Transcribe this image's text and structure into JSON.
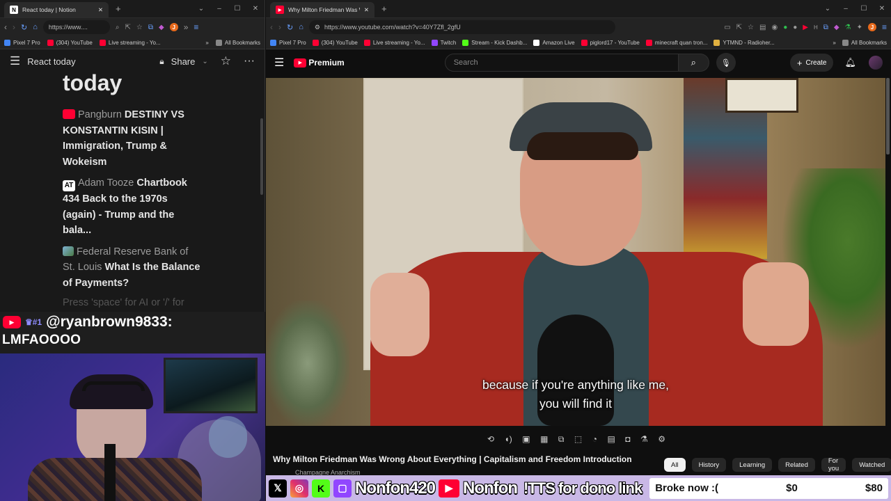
{
  "left_browser": {
    "tab_title": "React today | Notion",
    "url": "https://www....",
    "bookmarks": [
      "Pixel 7 Pro",
      "(304) YouTube",
      "Live streaming - Yo..."
    ],
    "all_bookmarks": "All Bookmarks",
    "notion": {
      "page_name": "React today",
      "share_label": "Share",
      "title": "today",
      "items": [
        {
          "source": "Pangburn",
          "link": "DESTINY VS KONSTANTIN KISIN | Immigration, Trump & Wokeism",
          "icon": "youtube-icon"
        },
        {
          "source": "Adam Tooze",
          "link": "Chartbook 434 Back to the 1970s (again) - Trump and the bala...",
          "icon": "at-icon"
        },
        {
          "source": "Federal Reserve Bank of St. Louis",
          "link": "What Is the Balance of Payments?",
          "icon": "image-icon"
        }
      ],
      "placeholder": "Press 'space' for AI or '/' for"
    }
  },
  "chat": {
    "username": "@ryanbrown9833:",
    "badge": "#1",
    "message": "LMFAOOOO"
  },
  "right_browser": {
    "tab_title": "Why Milton Friedman Was W",
    "url": "https://www.youtube.com/watch?v=40Y7Zfl_2gfU",
    "bookmarks": [
      "Pixel 7 Pro",
      "(304) YouTube",
      "Live streaming - Yo...",
      "Twitch",
      "Stream - Kick Dashb...",
      "Amazon Live",
      "piglord17 - YouTube",
      "minecraft quan tron...",
      "YTMND - Radioher..."
    ],
    "all_bookmarks": "All Bookmarks",
    "youtube": {
      "logo": "Premium",
      "search_placeholder": "Search",
      "create_label": "Create",
      "caption_line1": "because if you're anything like me,",
      "caption_line2": "you will find it",
      "video_title": "Why Milton Friedman Was Wrong About Everything | Capitalism and Freedom Introduction",
      "channel": "Champagne Anarchism",
      "chips": [
        "All",
        "History",
        "Learning",
        "Related",
        "For you",
        "Watched"
      ]
    }
  },
  "banner": {
    "kick_name": "Nonfon420",
    "youtube_name": "Nonfon",
    "tts_text": "!TTS for dono link",
    "goal_label": "Broke now :(",
    "goal_current": "$0",
    "goal_target": "$80"
  },
  "colors": {
    "youtube_red": "#ff0033",
    "kick_green": "#53fc18",
    "twitch_purple": "#9146ff",
    "banner_bg": "#c9b8e6"
  }
}
